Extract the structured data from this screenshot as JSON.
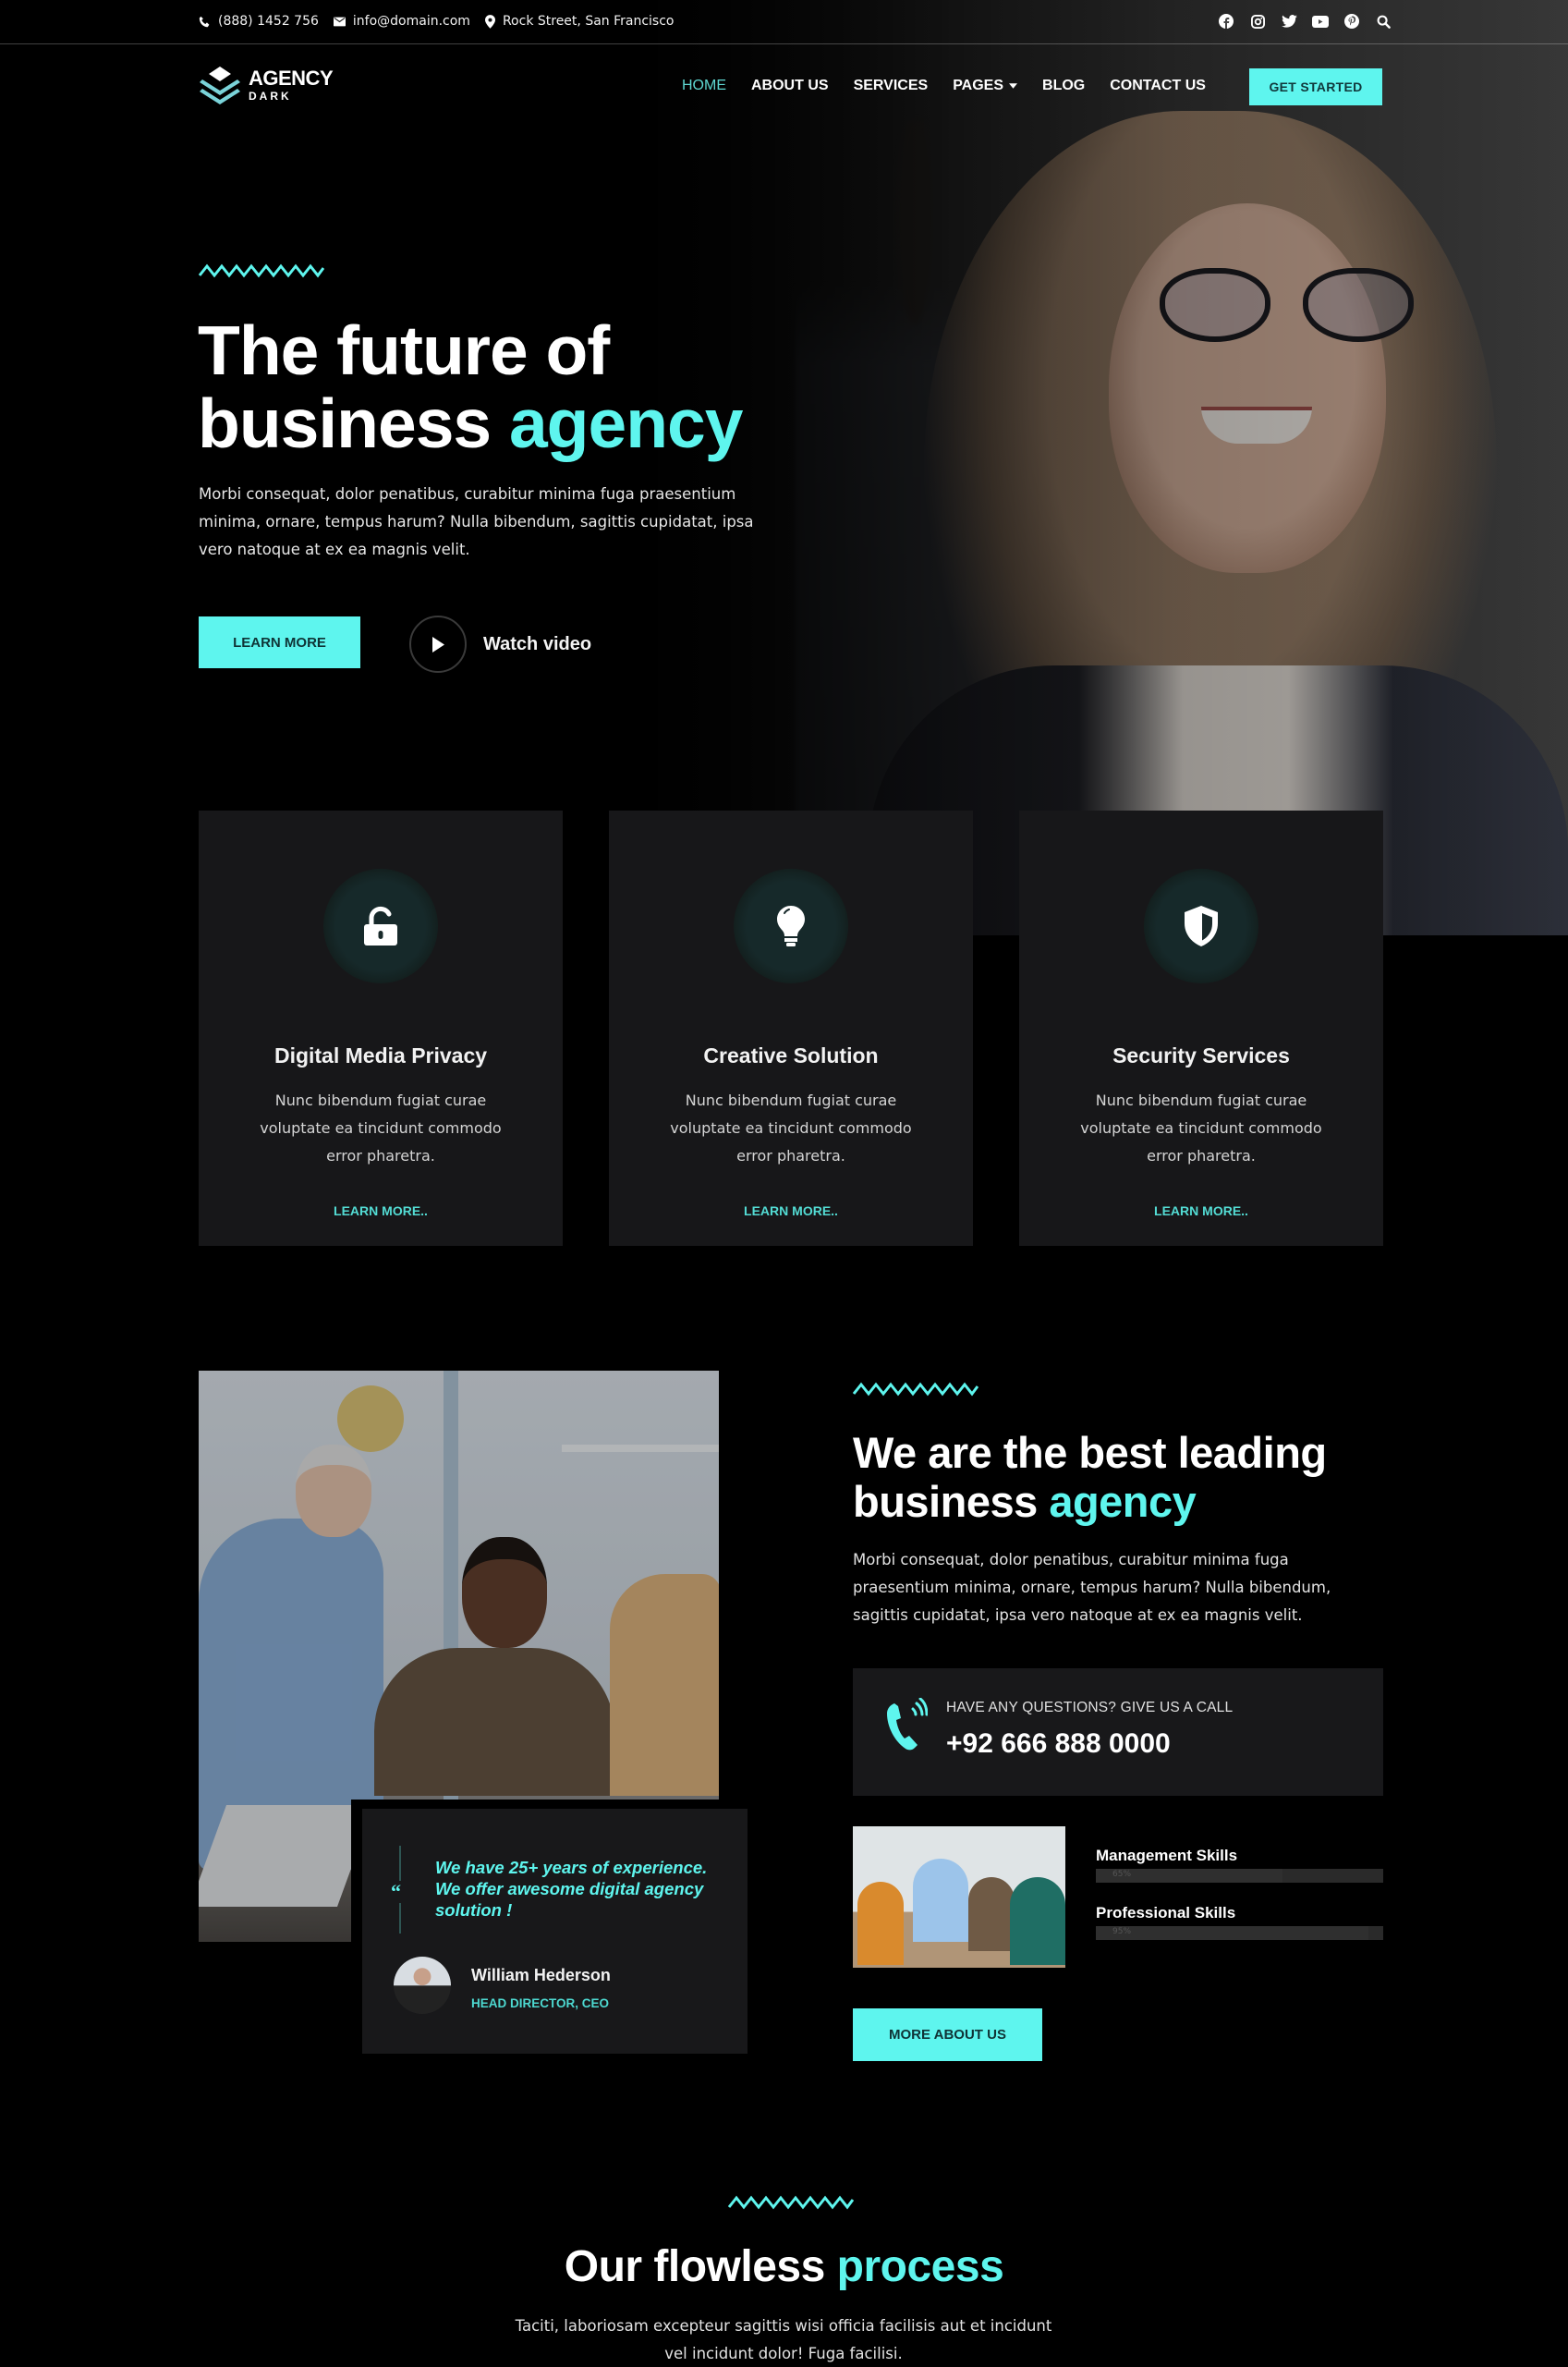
{
  "topbar": {
    "phone": "(888) 1452 756",
    "email": "info@domain.com",
    "address": "Rock Street, San Francisco",
    "social_icons": [
      "facebook-icon",
      "instagram-icon",
      "twitter-icon",
      "youtube-icon",
      "pinterest-icon",
      "search-icon"
    ]
  },
  "brand": {
    "title": "AGENCY",
    "subtitle": "DARK"
  },
  "nav": {
    "items": [
      {
        "label": "HOME",
        "active": true
      },
      {
        "label": "ABOUT US"
      },
      {
        "label": "SERVICES"
      },
      {
        "label": "PAGES",
        "has_dropdown": true
      },
      {
        "label": "BLOG"
      },
      {
        "label": "CONTACT US"
      }
    ],
    "cta": "GET STARTED"
  },
  "hero": {
    "title_line1": "The future of",
    "title_line2": "business",
    "title_accent": "agency",
    "text": "Morbi consequat, dolor penatibus, curabitur minima fuga praesentium minima, ornare, tempus harum? Nulla bibendum, sagittis cupidatat, ipsa vero natoque at ex ea magnis velit.",
    "primary_button": "LEARN MORE",
    "video_label": "Watch video"
  },
  "services": [
    {
      "icon": "unlock-icon",
      "title": "Digital Media Privacy",
      "text": "Nunc bibendum fugiat curae voluptate ea tincidunt commodo error pharetra.",
      "link": "LEARN MORE.."
    },
    {
      "icon": "lightbulb-icon",
      "title": "Creative Solution",
      "text": "Nunc bibendum fugiat curae voluptate ea tincidunt commodo error pharetra.",
      "link": "LEARN MORE.."
    },
    {
      "icon": "shield-icon",
      "title": "Security Services",
      "text": "Nunc bibendum fugiat curae voluptate ea tincidunt commodo error pharetra.",
      "link": "LEARN MORE.."
    }
  ],
  "about": {
    "quote": "We have 25+ years of experience. We offer awesome digital agency solution !",
    "author_name": "William Hederson",
    "author_role": "HEAD DIRECTOR, CEO",
    "title_line1": "We are the best leading",
    "title_line2": "business",
    "title_accent": "agency",
    "text": "Morbi consequat, dolor penatibus, curabitur minima fuga praesentium minima, ornare, tempus harum? Nulla bibendum, sagittis cupidatat, ipsa vero natoque at ex ea magnis velit.",
    "call_label": "HAVE ANY QUESTIONS? GIVE US A CALL",
    "call_number": "+92 666 888 0000",
    "skills": [
      {
        "label": "Management Skills",
        "percent": 65,
        "percent_label": "65%"
      },
      {
        "label": "Professional Skills",
        "percent": 95,
        "percent_label": "95%"
      }
    ],
    "button": "MORE ABOUT US"
  },
  "process": {
    "title": "Our flowless",
    "title_accent": "process",
    "text": "Taciti, laboriosam excepteur sagittis wisi officia facilisis aut et incidunt vel incidunt dolor! Fuga facilisi."
  },
  "colors": {
    "accent": "#5ef5ee",
    "card_bg": "#171719",
    "page_bg": "#000000"
  }
}
